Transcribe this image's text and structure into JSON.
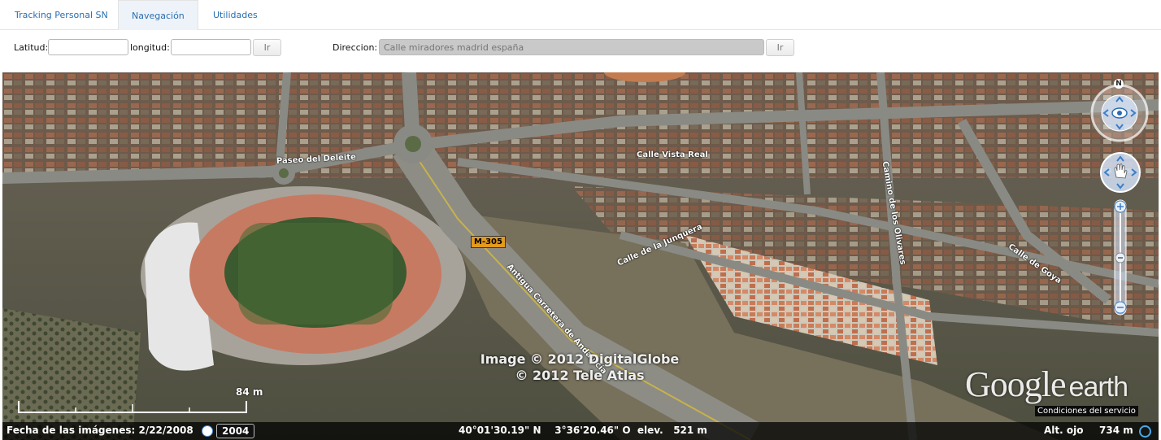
{
  "tabs": [
    {
      "label": "Tracking Personal SN"
    },
    {
      "label": "Navegación"
    },
    {
      "label": "Utilidades"
    }
  ],
  "form": {
    "lat_label": "Latitud:",
    "lat_value": "",
    "lon_label": "longitud:",
    "lon_value": "",
    "go1": "Ir",
    "dir_label": "Direccion:",
    "dir_placeholder": "Calle miradores madrid españa",
    "go2": "Ir"
  },
  "map": {
    "road_labels": {
      "m305": "M-305",
      "andalucia": "Antigua Carretera de Andalucía",
      "goya": "Calle de Goya",
      "junquera": "Calle de la Junquera",
      "vista_real": "Calle Vista Real",
      "olivares": "Camino de los Olivares",
      "damero": "Paseo del Deleite"
    },
    "credits": [
      "Image © 2012 DigitalGlobe",
      "© 2012 Tele Atlas"
    ],
    "scale": "84 m",
    "logo_google": "Google",
    "logo_earth": "earth",
    "terms": "Condiciones del servicio",
    "compass_n": "N",
    "status": {
      "imagery_date": "Fecha de las imágenes: 2/22/2008",
      "year": "2004",
      "coords": "40°01'30.19\" N    3°36'20.46\" O  elev.   521 m",
      "eye_alt_label": "Alt. ojo",
      "eye_alt_value": "734 m"
    }
  }
}
